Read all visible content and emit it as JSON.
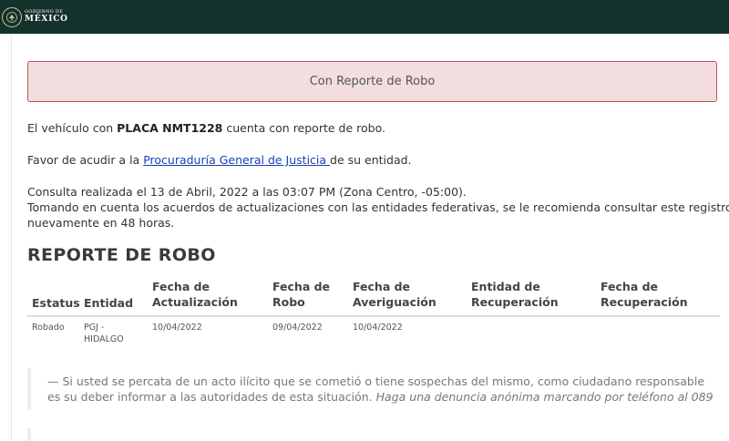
{
  "header": {
    "gov_line1": "GOBIERNO DE",
    "gov_line2": "MÉXICO",
    "emblem_icon": "eagle-emblem-icon"
  },
  "alert": {
    "text": "Con Reporte de Robo"
  },
  "info": {
    "line1_prefix": "El vehículo con ",
    "plate": "PLACA NMT1228",
    "line1_suffix": " cuenta con reporte de robo.",
    "line2_prefix": "Favor de acudir a la ",
    "line2_link": "Procuraduría General de Justicia ",
    "line2_suffix": "de su entidad.",
    "consult_line": "Consulta realizada el 13 de Abril, 2022 a las 03:07 PM (Zona Centro, -05:00).",
    "note_line1": "Tomando en cuenta los acuerdos de actualizaciones con las entidades federativas, se le recomienda consultar este registro",
    "note_line2": "nuevamente en 48 horas."
  },
  "report": {
    "title": "REPORTE DE ROBO",
    "headers": {
      "estatus": "Estatus",
      "entidad": "Entidad",
      "fecha_act_1": "Fecha de",
      "fecha_act_2": "Actualización",
      "fecha_robo_1": "Fecha de",
      "fecha_robo_2": "Robo",
      "fecha_ave_1": "Fecha de",
      "fecha_ave_2": "Averiguación",
      "entidad_rec_1": "Entidad de",
      "entidad_rec_2": "Recuperación",
      "fecha_rec_1": "Fecha de",
      "fecha_rec_2": "Recuperación"
    },
    "row": {
      "estatus": "Robado",
      "entidad_1": "PGJ -",
      "entidad_2": "HIDALGO",
      "fecha_actualizacion": "10/04/2022",
      "fecha_robo": "09/04/2022",
      "fecha_averiguacion": "10/04/2022",
      "entidad_recuperacion": "",
      "fecha_recuperacion": ""
    }
  },
  "quote": {
    "dash": "—",
    "text": " Si usted se percata de un acto ilícito que se cometió o tiene sospechas del mismo, como ciudadano responsable es su deber informar a las autoridades de esta situación. ",
    "emphasis": "Haga una denuncia anónima marcando por teléfono al 089"
  },
  "colors": {
    "header_bg": "#13322b",
    "alert_bg": "#f2dede",
    "alert_border": "#c7495e",
    "link": "#1a3fb5"
  }
}
